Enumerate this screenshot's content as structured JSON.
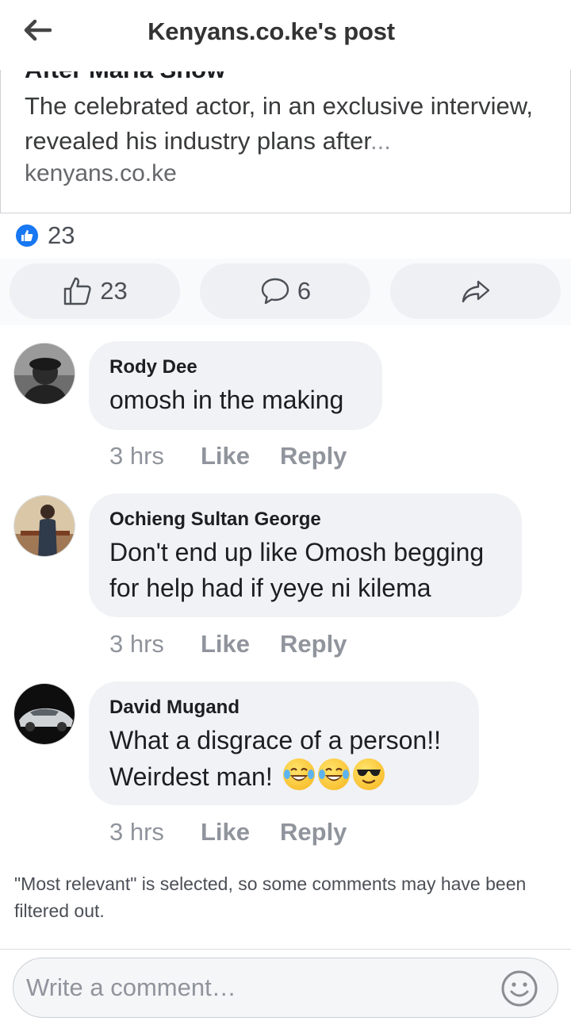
{
  "topbar": {
    "title": "Kenyans.co.ke's post"
  },
  "link_card": {
    "title_cut": "After Maria Show",
    "description": "The celebrated actor, in an exclusive interview, revealed his industry plans after",
    "ellipsis": "...",
    "domain": "kenyans.co.ke"
  },
  "reactions": {
    "count": "23"
  },
  "actions": {
    "like_count": "23",
    "comment_count": "6"
  },
  "comments": [
    {
      "author": "Rody Dee",
      "text": "omosh in the making",
      "time": "3 hrs",
      "like_label": "Like",
      "reply_label": "Reply"
    },
    {
      "author": "Ochieng Sultan George",
      "text_line1": "Don't end up like Omosh begging",
      "text_line2": "for help had if yeye ni kilema",
      "time": "3 hrs",
      "like_label": "Like",
      "reply_label": "Reply"
    },
    {
      "author": "David Mugand",
      "text_line1": "What a disgrace of a person!!",
      "text_line2": "Weirdest man!",
      "emojis": [
        "tears-of-joy-emoji",
        "tears-of-joy-emoji",
        "sunglasses-emoji"
      ],
      "time": "3 hrs",
      "like_label": "Like",
      "reply_label": "Reply"
    }
  ],
  "filter_note": "\"Most relevant\" is selected, so some comments may have been filtered out.",
  "composer": {
    "placeholder": "Write a comment…"
  },
  "colors": {
    "accent": "#1877f2",
    "bubble": "#f0f2f5",
    "muted": "#90949c"
  }
}
